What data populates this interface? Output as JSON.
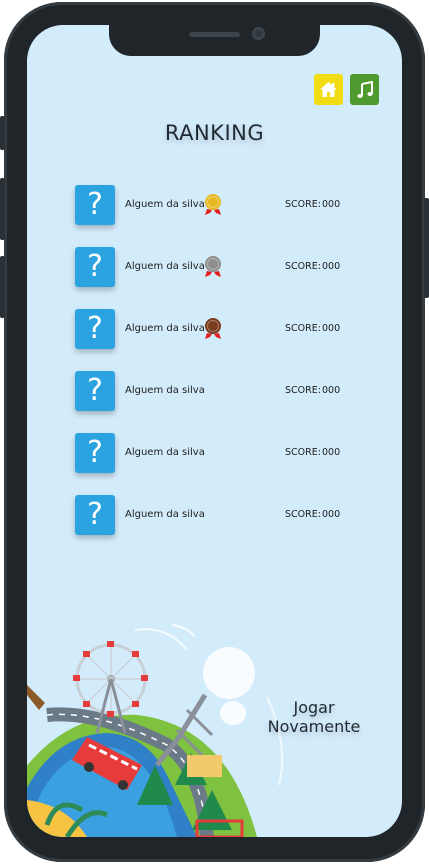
{
  "header": {
    "home_icon": "home-icon",
    "music_icon": "music-note-icon",
    "home_color": "#f2dd14",
    "music_color": "#4e9a2e"
  },
  "title": "RANKING",
  "ranking": [
    {
      "avatar": "?",
      "name": "Alguem da silva",
      "medal": "gold",
      "score_label": "SCORE:",
      "score": "000"
    },
    {
      "avatar": "?",
      "name": "Alguem da silva",
      "medal": "silver",
      "score_label": "SCORE:",
      "score": "000"
    },
    {
      "avatar": "?",
      "name": "Alguem da silva",
      "medal": "bronze",
      "score_label": "SCORE:",
      "score": "000"
    },
    {
      "avatar": "?",
      "name": "Alguem da silva",
      "medal": "",
      "score_label": "SCORE:",
      "score": "000"
    },
    {
      "avatar": "?",
      "name": "Alguem da silva",
      "medal": "",
      "score_label": "SCORE:",
      "score": "000"
    },
    {
      "avatar": "?",
      "name": "Alguem da silva",
      "medal": "",
      "score_label": "SCORE:",
      "score": "000"
    }
  ],
  "play_again": {
    "line1": "Jogar",
    "line2": "Novamente"
  },
  "colors": {
    "background": "#d3ecfb",
    "avatar": "#2aa3e0",
    "gold": "#e8b923",
    "silver": "#8e8e8e",
    "bronze": "#7a3b1e"
  }
}
